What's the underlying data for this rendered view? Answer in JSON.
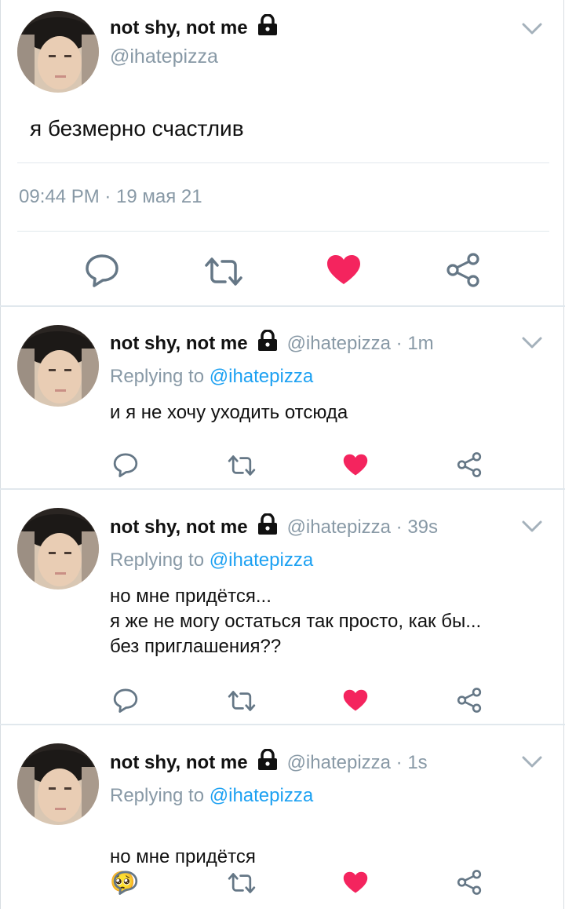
{
  "main_tweet": {
    "name": "not shy, not me",
    "handle": "@ihatepizza",
    "text": "я безмерно счастлив",
    "timestamp": "09:44 PM · 19 мая 21"
  },
  "replies": [
    {
      "name": "not shy, not me",
      "handle_time": "@ihatepizza · 1m",
      "replying_prefix": "Replying to ",
      "replying_to": "@ihatepizza",
      "text": "и я не хочу уходить отсюда"
    },
    {
      "name": "not shy, not me",
      "handle_time": "@ihatepizza · 39s",
      "replying_prefix": "Replying to ",
      "replying_to": "@ihatepizza",
      "text": "но мне придётся...\nя же не могу остаться так просто, как бы...\nбез приглашения??"
    },
    {
      "name": "not shy, not me",
      "handle_time": "@ihatepizza · 1s",
      "replying_prefix": "Replying to ",
      "replying_to": "@ihatepizza",
      "text": "но мне придётся",
      "emoji": "🥺"
    }
  ],
  "icons": {
    "reply": "reply-icon",
    "retweet": "retweet-icon",
    "like": "heart-icon",
    "share": "share-icon",
    "lock": "lock-icon",
    "menu": "chevron-down-icon"
  },
  "colors": {
    "like": "#f4245e",
    "icon": "#657786",
    "muted": "#8899a6",
    "mention": "#1da1f2"
  }
}
